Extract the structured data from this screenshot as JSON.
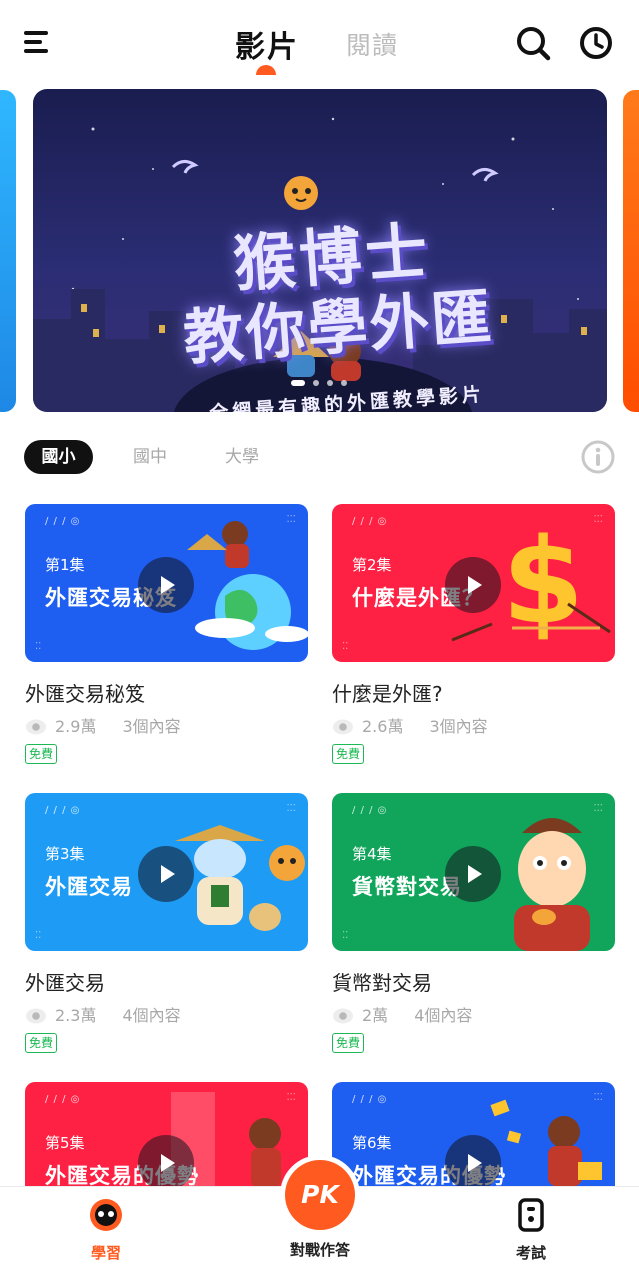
{
  "header": {
    "tabs": [
      {
        "label": "影片",
        "active": true
      },
      {
        "label": "閱讀",
        "active": false
      }
    ],
    "menu_icon": "hamburger-menu-icon",
    "search_icon": "search-icon",
    "history_icon": "clock-icon",
    "accent_color": "#ff5a1f"
  },
  "banner": {
    "title_line1": "猴博士",
    "title_line2": "教你學外匯",
    "subtitle": "全網最有趣的外匯教學影片",
    "slide_count": 4,
    "active_slide": 1
  },
  "filter": {
    "levels": [
      "國小",
      "國中",
      "大學"
    ],
    "selected": "國小",
    "info_icon": "info-icon"
  },
  "videos": [
    {
      "episode": "第1集",
      "thumb_title": "外匯交易秘笈",
      "title": "外匯交易秘笈",
      "views": "2.9萬",
      "contents": "3個內容",
      "badge": "免費",
      "color": "#1e5ef0"
    },
    {
      "episode": "第2集",
      "thumb_title": "什麼是外匯？",
      "title": "什麼是外匯?",
      "views": "2.6萬",
      "contents": "3個內容",
      "badge": "免費",
      "color": "#ff2143"
    },
    {
      "episode": "第3集",
      "thumb_title": "外匯交易",
      "title": "外匯交易",
      "views": "2.3萬",
      "contents": "4個內容",
      "badge": "免費",
      "color": "#1d9bf5"
    },
    {
      "episode": "第4集",
      "thumb_title": "貨幣對交易",
      "title": "貨幣對交易",
      "views": "2萬",
      "contents": "4個內容",
      "badge": "免費",
      "color": "#10a55a"
    },
    {
      "episode": "第5集",
      "thumb_title": "外匯交易的優勢",
      "color": "#ff2143"
    },
    {
      "episode": "第6集",
      "thumb_title": "外匯交易的優勢",
      "color": "#1e5ef0"
    }
  ],
  "bottom_nav": {
    "learn": {
      "label": "學習",
      "icon": "learn-face-icon",
      "active": true
    },
    "pk": {
      "label": "對戰作答",
      "badge_text": "PK"
    },
    "exam": {
      "label": "考試",
      "icon": "exam-icon",
      "active": false
    }
  }
}
